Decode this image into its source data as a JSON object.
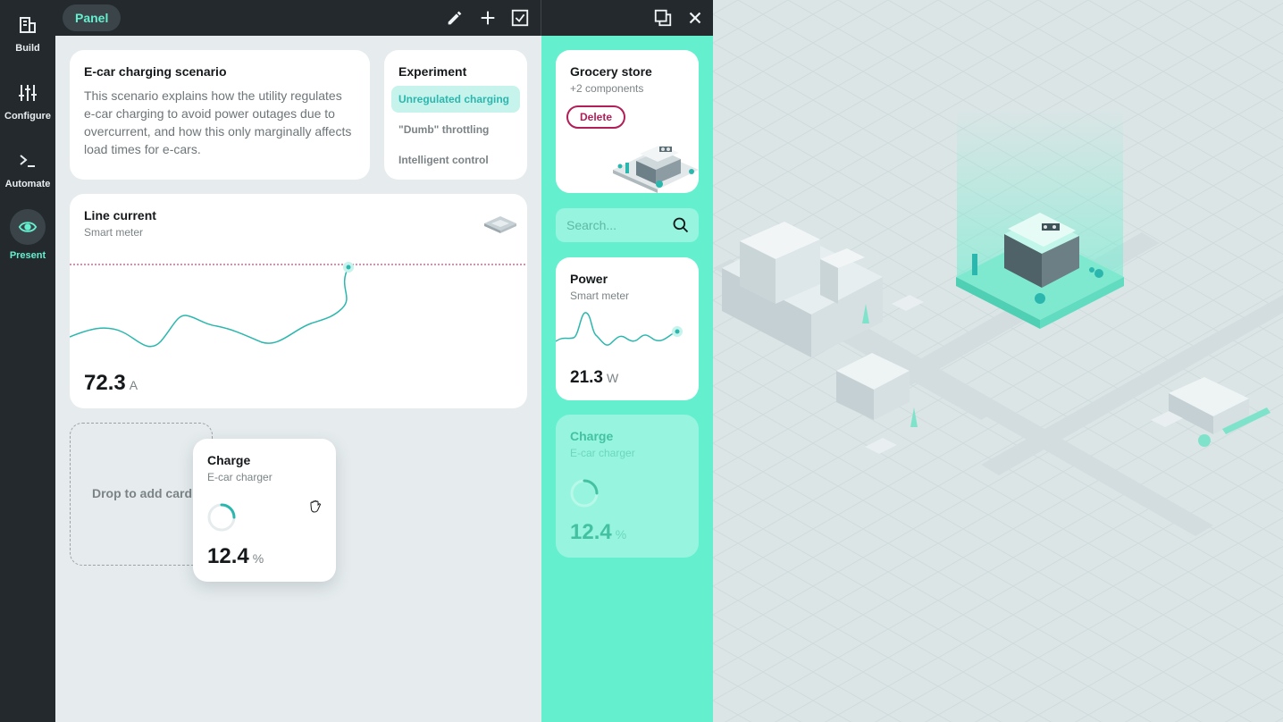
{
  "nav": {
    "items": [
      {
        "label": "Build",
        "icon": "building-icon"
      },
      {
        "label": "Configure",
        "icon": "sliders-icon"
      },
      {
        "label": "Automate",
        "icon": "terminal-icon"
      },
      {
        "label": "Present",
        "icon": "eye-icon"
      }
    ],
    "active": "Present"
  },
  "topbar": {
    "panel_label": "Panel",
    "icons": [
      "pencil-icon",
      "plus-icon",
      "checkbox-icon",
      "window-icon",
      "close-icon"
    ]
  },
  "scenario": {
    "title": "E-car charging scenario",
    "description": "This scenario explains how the utility regulates e-car charging to avoid power outages due to overcurrent, and how this only marginally affects load times for e-cars."
  },
  "experiment": {
    "title": "Experiment",
    "options": [
      "Unregulated charging",
      "\"Dumb\" throttling",
      "Intelligent control"
    ],
    "selected": "Unregulated charging"
  },
  "line_current": {
    "title": "Line current",
    "subtitle": "Smart meter",
    "value": "72.3",
    "unit": "A"
  },
  "dropzone": {
    "label": "Drop to add card"
  },
  "charge_card": {
    "title": "Charge",
    "subtitle": "E-car charger",
    "value": "12.4",
    "unit": "%",
    "progress": 0.25
  },
  "components": {
    "grocery": {
      "title": "Grocery store",
      "subtitle": "+2 components",
      "delete_label": "Delete"
    },
    "search": {
      "placeholder": "Search..."
    },
    "power": {
      "title": "Power",
      "subtitle": "Smart meter",
      "value": "21.3",
      "unit": "W"
    },
    "charge_ghost": {
      "title": "Charge",
      "subtitle": "E-car charger",
      "value": "12.4",
      "unit": "%"
    }
  },
  "colors": {
    "accent": "#64f0cf",
    "teal": "#2bb7ae",
    "danger": "#b21e58",
    "dark": "#23292d"
  }
}
